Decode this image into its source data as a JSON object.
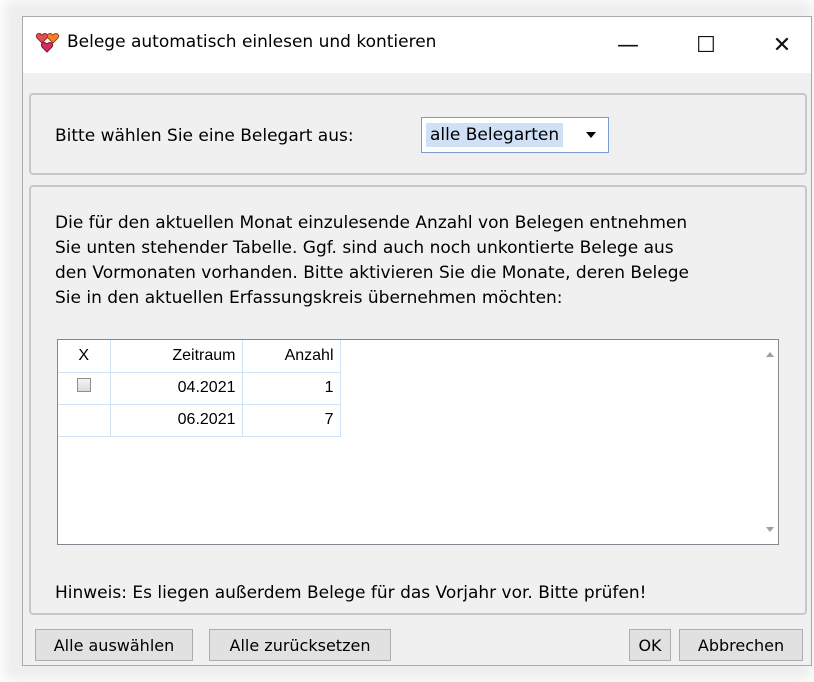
{
  "window": {
    "title": "Belege automatisch einlesen und kontieren",
    "controls": {
      "minimize": "—",
      "maximize": "☐",
      "close": "✕"
    }
  },
  "selection": {
    "prompt": "Bitte wählen Sie eine Belegart aus:",
    "selected_value": "alle Belegarten"
  },
  "description": {
    "lines": [
      "Die für den aktuellen Monat einzulesende Anzahl von Belegen entnehmen",
      "Sie unten stehender Tabelle. Ggf. sind auch noch unkontierte Belege aus",
      "den Vormonaten vorhanden. Bitte aktivieren Sie die Monate, deren Belege",
      "Sie in den aktuellen Erfassungskreis übernehmen möchten:"
    ]
  },
  "table": {
    "headers": {
      "x": "X",
      "zeitraum": "Zeitraum",
      "anzahl": "Anzahl"
    },
    "rows": [
      {
        "has_checkbox": true,
        "checked": false,
        "zeitraum": "04.2021",
        "anzahl": "1"
      },
      {
        "has_checkbox": false,
        "checked": false,
        "zeitraum": "06.2021",
        "anzahl": "7"
      }
    ]
  },
  "hint": "Hinweis: Es liegen außerdem Belege für das Vorjahr vor. Bitte prüfen!",
  "buttons": {
    "select_all": "Alle auswählen",
    "reset_all": "Alle zurücksetzen",
    "ok": "OK",
    "cancel": "Abbrechen"
  },
  "icons": {
    "app": "hearts-icon",
    "dropdown": "chevron-down-icon"
  }
}
